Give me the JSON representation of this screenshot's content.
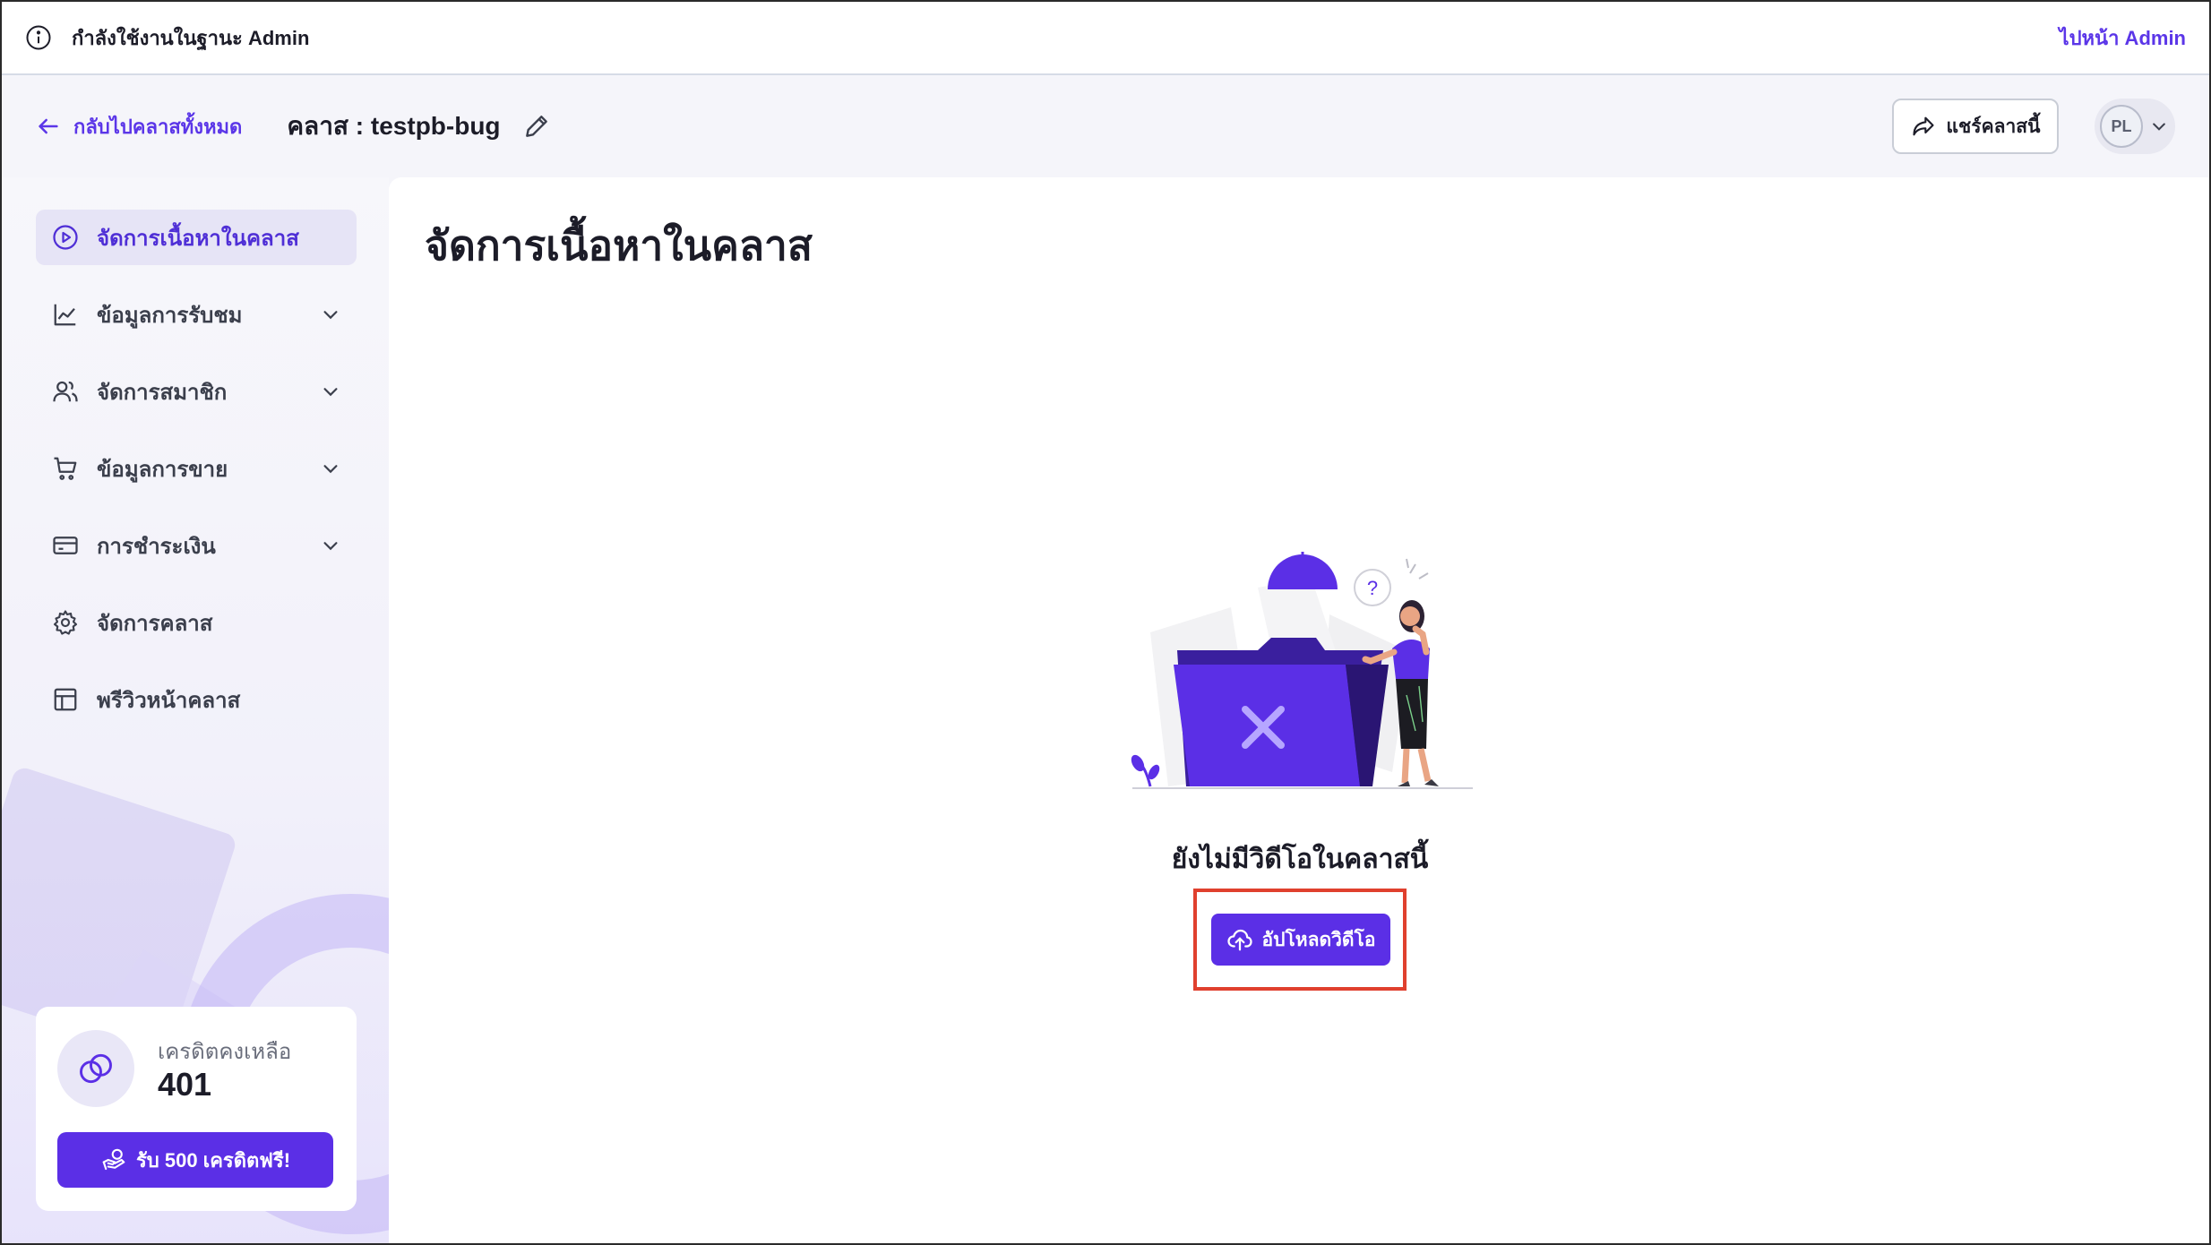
{
  "admin_bar": {
    "message": "กำลังใช้งานในฐานะ Admin",
    "goto_admin": "ไปหน้า Admin"
  },
  "header": {
    "back_label": "กลับไปคลาสทั้งหมด",
    "class_title": "คลาส : testpb-bug",
    "share_label": "แชร์คลาสนี้",
    "avatar_initials": "PL"
  },
  "sidebar": {
    "items": [
      {
        "label": "จัดการเนื้อหาในคลาส",
        "icon": "play-circle-icon",
        "active": true,
        "expandable": false
      },
      {
        "label": "ข้อมูลการรับชม",
        "icon": "line-chart-icon",
        "active": false,
        "expandable": true
      },
      {
        "label": "จัดการสมาชิก",
        "icon": "users-icon",
        "active": false,
        "expandable": true
      },
      {
        "label": "ข้อมูลการขาย",
        "icon": "cart-icon",
        "active": false,
        "expandable": true
      },
      {
        "label": "การชำระเงิน",
        "icon": "credit-card-icon",
        "active": false,
        "expandable": true
      },
      {
        "label": "จัดการคลาส",
        "icon": "gear-icon",
        "active": false,
        "expandable": false
      },
      {
        "label": "พรีวิวหน้าคลาส",
        "icon": "layout-icon",
        "active": false,
        "expandable": false
      }
    ],
    "credit": {
      "label": "เครดิตคงเหลือ",
      "value": "401",
      "button_label": "รับ 500 เครดิตฟรี!"
    }
  },
  "main": {
    "title": "จัดการเนื้อหาในคลาส",
    "empty_text": "ยังไม่มีวิดีโอในคลาสนี้",
    "upload_label": "อัปโหลดวิดีโอ"
  },
  "colors": {
    "accent": "#5b2fe6",
    "highlight": "#e0402e"
  }
}
